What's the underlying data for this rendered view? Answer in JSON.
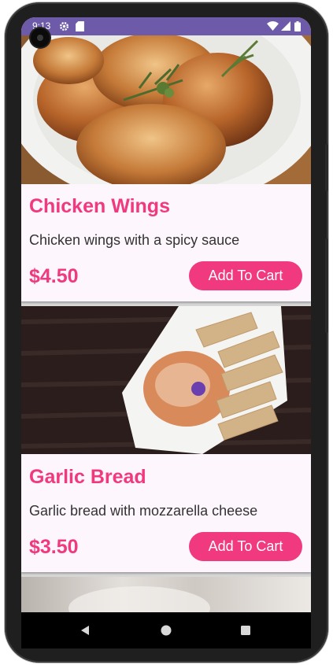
{
  "status_bar": {
    "time": "9:13",
    "icons": [
      "settings-icon",
      "sd-card-icon",
      "wifi-icon",
      "cell-signal-icon",
      "battery-icon"
    ]
  },
  "items": [
    {
      "name": "Chicken Wings",
      "description": "Chicken wings with a spicy sauce",
      "price": "$4.50",
      "button": "Add To Cart"
    },
    {
      "name": "Garlic Bread",
      "description": "Garlic bread with mozzarella cheese",
      "price": "$3.50",
      "button": "Add To Cart"
    }
  ],
  "nav_bar": {
    "icons": [
      "back-icon",
      "home-icon",
      "recents-icon"
    ]
  },
  "colors": {
    "accent": "#f0397f",
    "status_bar": "#6d5aa8",
    "card_background": "#fdf6fc"
  }
}
